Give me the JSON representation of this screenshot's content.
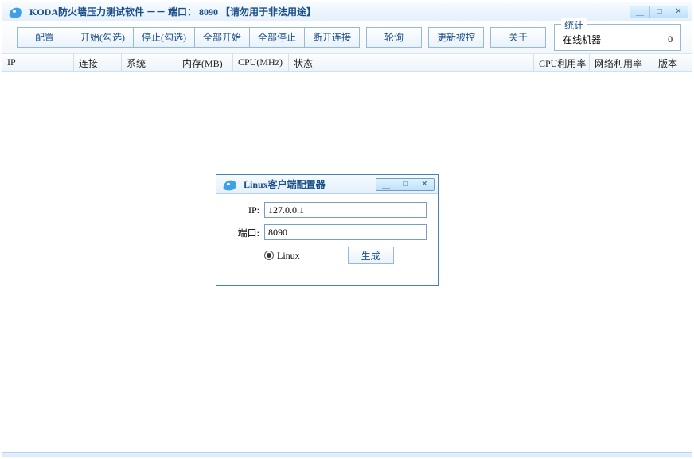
{
  "main": {
    "title": "KODA防火墙压力测试软件  －－  端口： 8090  【请勿用于非法用途】",
    "toolbar": {
      "config": "配置",
      "start_checked": "开始(勾选)",
      "stop_checked": "停止(勾选)",
      "start_all": "全部开始",
      "stop_all": "全部停止",
      "disconnect": "断开连接",
      "poll": "轮询",
      "update_ctrl": "更新被控",
      "about": "关于"
    },
    "stats": {
      "legend": "统计",
      "label": "在线机器",
      "value": "0"
    },
    "columns": {
      "ip": "IP",
      "conn": "连接",
      "system": "系统",
      "mem": "内存(MB)",
      "cpu": "CPU(MHz)",
      "status": "状态",
      "cpu_util": "CPU利用率",
      "net_util": "网络利用率",
      "version": "版本"
    }
  },
  "dialog": {
    "title": "Linux客户端配置器",
    "ip_label": "IP:",
    "ip_value": "127.0.0.1",
    "port_label": "端口:",
    "port_value": "8090",
    "radio_linux": "Linux",
    "generate": "生成"
  }
}
